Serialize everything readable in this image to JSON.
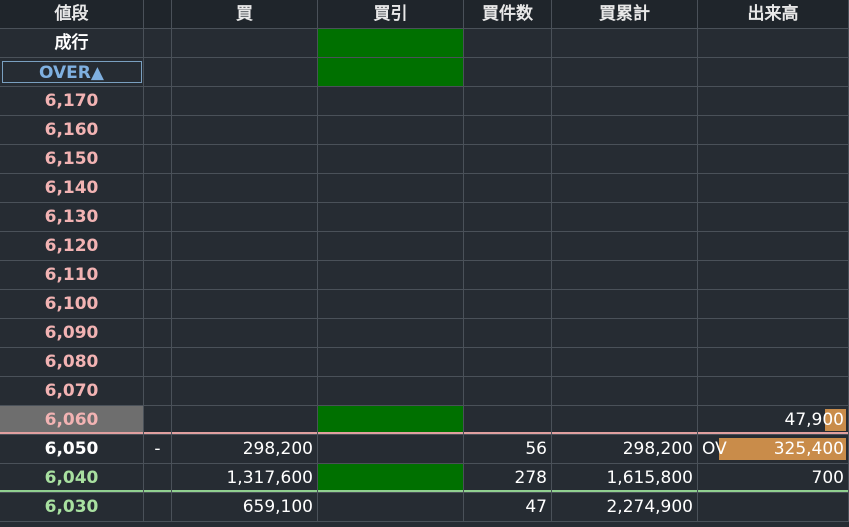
{
  "headers": [
    "値段",
    "",
    "買",
    "買引",
    "買件数",
    "買累計",
    "出来高"
  ],
  "market_row": {
    "label": "成行"
  },
  "over_button": {
    "label": "OVER▲"
  },
  "rows": [
    {
      "price": "6,170",
      "flag": "",
      "buy": "",
      "buy_close": false,
      "count": "",
      "cumulative": "",
      "volume": "",
      "vol_bar": 0,
      "ov": ""
    },
    {
      "price": "6,160",
      "flag": "",
      "buy": "",
      "buy_close": false,
      "count": "",
      "cumulative": "",
      "volume": "",
      "vol_bar": 0,
      "ov": ""
    },
    {
      "price": "6,150",
      "flag": "",
      "buy": "",
      "buy_close": false,
      "count": "",
      "cumulative": "",
      "volume": "",
      "vol_bar": 0,
      "ov": ""
    },
    {
      "price": "6,140",
      "flag": "",
      "buy": "",
      "buy_close": false,
      "count": "",
      "cumulative": "",
      "volume": "",
      "vol_bar": 0,
      "ov": ""
    },
    {
      "price": "6,130",
      "flag": "",
      "buy": "",
      "buy_close": false,
      "count": "",
      "cumulative": "",
      "volume": "",
      "vol_bar": 0,
      "ov": ""
    },
    {
      "price": "6,120",
      "flag": "",
      "buy": "",
      "buy_close": false,
      "count": "",
      "cumulative": "",
      "volume": "",
      "vol_bar": 0,
      "ov": ""
    },
    {
      "price": "6,110",
      "flag": "",
      "buy": "",
      "buy_close": false,
      "count": "",
      "cumulative": "",
      "volume": "",
      "vol_bar": 0,
      "ov": ""
    },
    {
      "price": "6,100",
      "flag": "",
      "buy": "",
      "buy_close": false,
      "count": "",
      "cumulative": "",
      "volume": "",
      "vol_bar": 0,
      "ov": ""
    },
    {
      "price": "6,090",
      "flag": "",
      "buy": "",
      "buy_close": false,
      "count": "",
      "cumulative": "",
      "volume": "",
      "vol_bar": 0,
      "ov": ""
    },
    {
      "price": "6,080",
      "flag": "",
      "buy": "",
      "buy_close": false,
      "count": "",
      "cumulative": "",
      "volume": "",
      "vol_bar": 0,
      "ov": ""
    },
    {
      "price": "6,070",
      "flag": "",
      "buy": "",
      "buy_close": false,
      "count": "",
      "cumulative": "",
      "volume": "",
      "vol_bar": 0,
      "ov": ""
    },
    {
      "price": "6,060",
      "flag": "",
      "buy": "",
      "buy_close": true,
      "count": "",
      "cumulative": "",
      "volume": "47,900",
      "vol_bar": 0.14,
      "ov": ""
    },
    {
      "price": "6,050",
      "flag": "-",
      "buy": "298,200",
      "buy_close": false,
      "count": "56",
      "cumulative": "298,200",
      "volume": "325,400",
      "vol_bar": 0.85,
      "ov": "OV"
    },
    {
      "price": "6,040",
      "flag": "",
      "buy": "1,317,600",
      "buy_close": true,
      "count": "278",
      "cumulative": "1,615,800",
      "volume": "700",
      "vol_bar": 0,
      "ov": ""
    },
    {
      "price": "6,030",
      "flag": "",
      "buy": "659,100",
      "buy_close": false,
      "count": "47",
      "cumulative": "2,274,900",
      "volume": "",
      "vol_bar": 0,
      "ov": ""
    }
  ],
  "colors": {
    "background": "#262c33",
    "price_above": "#f2b3b3",
    "price_below": "#a8e0a0",
    "buy_close": "#007000",
    "volume_bar": "#c98c4a",
    "over_button": "#7fb0e0"
  }
}
